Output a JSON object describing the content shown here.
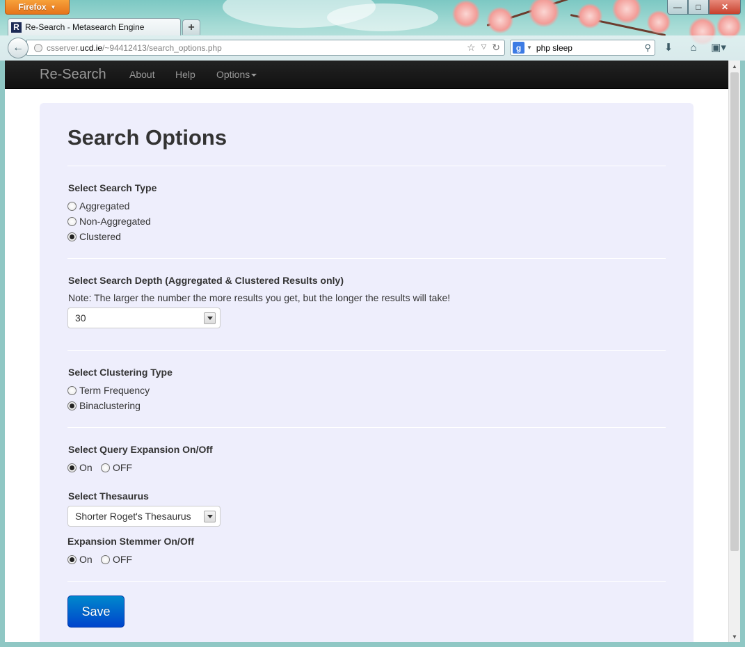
{
  "browser": {
    "app_button": "Firefox",
    "tab_title": "Re-Search - Metasearch Engine",
    "tab_favicon": "R",
    "url_prefix": "csserver.",
    "url_host": "ucd.ie",
    "url_path": "/~94412413/search_options.php",
    "search_engine_letter": "g",
    "search_value": "php sleep"
  },
  "site": {
    "brand": "Re-Search",
    "nav": [
      {
        "label": "About"
      },
      {
        "label": "Help"
      },
      {
        "label": "Options"
      }
    ]
  },
  "form": {
    "title": "Search Options",
    "search_type": {
      "label": "Select Search Type",
      "options": [
        "Aggregated",
        "Non-Aggregated",
        "Clustered"
      ],
      "selected": "Clustered"
    },
    "search_depth": {
      "label": "Select Search Depth (Aggregated & Clustered Results only)",
      "note": "Note: The larger the number the more results you get, but the longer the results will take!",
      "value": "30"
    },
    "clustering_type": {
      "label": "Select Clustering Type",
      "options": [
        "Term Frequency",
        "Binaclustering"
      ],
      "selected": "Binaclustering"
    },
    "query_expansion": {
      "label": "Select Query Expansion On/Off",
      "on_label": "On",
      "off_label": "OFF",
      "selected": "On"
    },
    "thesaurus": {
      "label": "Select Thesaurus",
      "value": "Shorter Roget's Thesaurus"
    },
    "stemmer": {
      "label": "Expansion Stemmer On/Off",
      "on_label": "On",
      "off_label": "OFF",
      "selected": "On"
    },
    "save_label": "Save"
  }
}
